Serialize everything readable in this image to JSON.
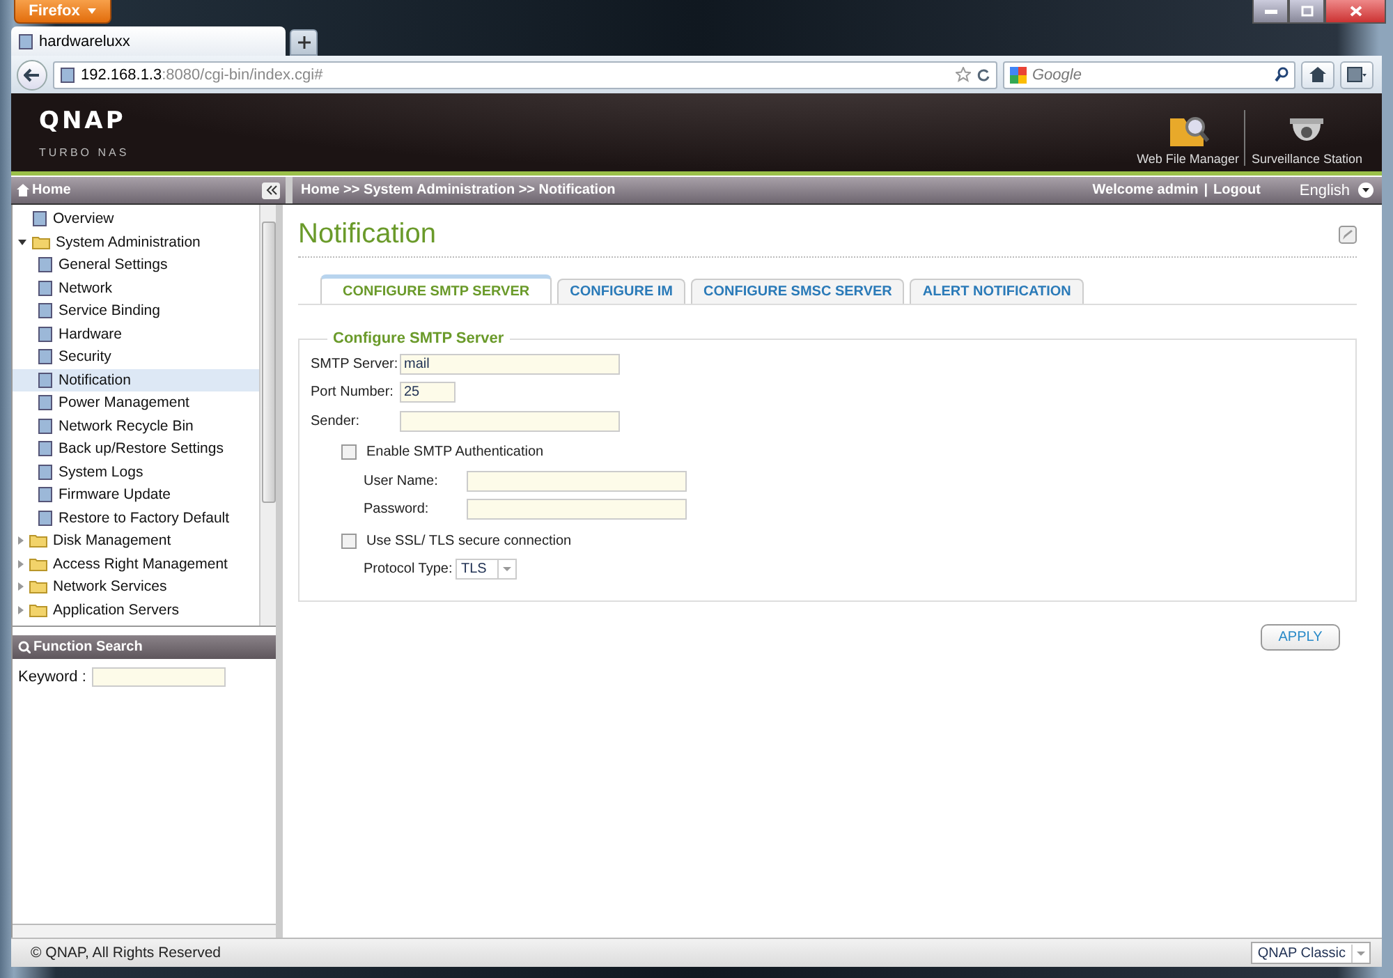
{
  "browser": {
    "menu_button": "Firefox",
    "tab": {
      "title": "hardwareluxx"
    },
    "url": {
      "host": "192.168.1.3",
      "path": ":8080/cgi-bin/index.cgi#"
    },
    "search": {
      "placeholder": "Google"
    }
  },
  "header": {
    "logo": "QNAP",
    "subtitle": "TURBO NAS",
    "apps": [
      {
        "label": "Web File Manager",
        "kind": "folder"
      },
      {
        "label": "Surveillance Station",
        "kind": "camera"
      }
    ]
  },
  "sidebar": {
    "title": "Home",
    "tree": [
      {
        "label": "Overview",
        "selected": false
      },
      {
        "label": "System Administration",
        "expanded": true,
        "children": [
          {
            "label": "General Settings",
            "selected": false
          },
          {
            "label": "Network",
            "selected": false
          },
          {
            "label": "Service Binding",
            "selected": false
          },
          {
            "label": "Hardware",
            "selected": false
          },
          {
            "label": "Security",
            "selected": false
          },
          {
            "label": "Notification",
            "selected": true
          },
          {
            "label": "Power Management",
            "selected": false
          },
          {
            "label": "Network Recycle Bin",
            "selected": false
          },
          {
            "label": "Back up/Restore Settings",
            "selected": false
          },
          {
            "label": "System Logs",
            "selected": false
          },
          {
            "label": "Firmware Update",
            "selected": false
          },
          {
            "label": "Restore to Factory Default",
            "selected": false
          }
        ]
      },
      {
        "label": "Disk Management",
        "expanded": false
      },
      {
        "label": "Access Right Management",
        "expanded": false
      },
      {
        "label": "Network Services",
        "expanded": false
      },
      {
        "label": "Application Servers",
        "expanded": false
      }
    ],
    "search": {
      "title": "Function Search",
      "label": "Keyword :"
    }
  },
  "topbar": {
    "breadcrumb": "Home >> System Administration >> Notification",
    "welcome": "Welcome admin",
    "separator": "|",
    "logout": "Logout",
    "language": "English"
  },
  "page": {
    "title": "Notification",
    "tabs": [
      {
        "label": "CONFIGURE SMTP SERVER",
        "selected": true
      },
      {
        "label": "CONFIGURE IM",
        "selected": false
      },
      {
        "label": "CONFIGURE SMSC SERVER",
        "selected": false
      },
      {
        "label": "ALERT NOTIFICATION",
        "selected": false
      }
    ],
    "legend": "Configure SMTP Server",
    "fields": [
      {
        "kind": "text",
        "label": "SMTP Server:",
        "value": "mail"
      },
      {
        "kind": "number",
        "label": "Port Number:",
        "value": "25"
      },
      {
        "kind": "text",
        "label": "Sender:"
      },
      {
        "kind": "checkbox",
        "label": "Enable SMTP Authentication",
        "checked": false,
        "children": [
          {
            "kind": "text",
            "label": "User Name:"
          },
          {
            "kind": "text",
            "label": "Password:"
          }
        ]
      },
      {
        "kind": "checkbox",
        "label": "Use SSL/ TLS secure connection",
        "checked": false,
        "children": [
          {
            "kind": "select",
            "label": "Protocol Type:",
            "value": "TLS"
          }
        ]
      }
    ],
    "apply": "APPLY"
  },
  "footer": {
    "copyright": "© QNAP, All Rights Reserved",
    "theme": "QNAP Classic"
  }
}
